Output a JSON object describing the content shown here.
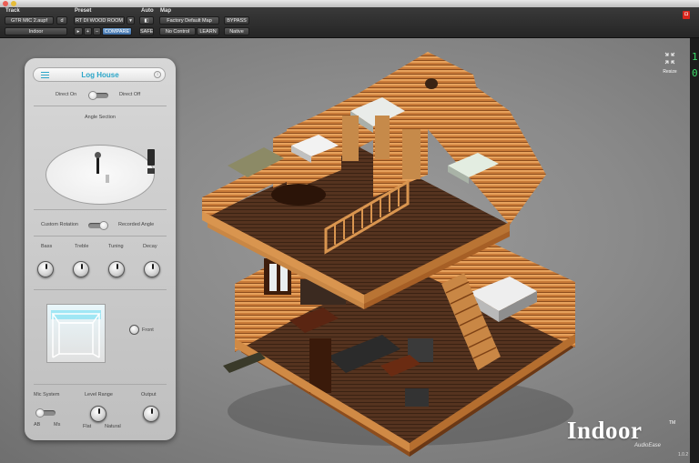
{
  "host": {
    "track_label": "Track",
    "track_name": "GTR MIC 2.aupf",
    "track_letter": "d",
    "track_insert": "Indoor",
    "preset_label": "Preset",
    "preset_name": "RT DI WOOD ROOM",
    "preset_plus": "+",
    "preset_minus": "−",
    "compare": "COMPARE",
    "auto_label": "Auto",
    "safe": "SAFE",
    "map_label": "Map",
    "map_name": "Factory Default Map",
    "no_control": "No Control",
    "learn": "LEARN",
    "bypass": "BYPASS",
    "native": "Native",
    "close_glyph": "✕",
    "record_glyph": "◘",
    "side_digits": [
      "1",
      "0"
    ]
  },
  "panel": {
    "title": "Log House",
    "direct_on": "Direct On",
    "direct_off": "Direct Off",
    "angle_section": "Angle Section",
    "custom_rotation": "Custom Rotation",
    "recorded_angle": "Recorded Angle",
    "knobs": [
      {
        "label": "Bass"
      },
      {
        "label": "Treble"
      },
      {
        "label": "Tuning"
      },
      {
        "label": "Decay"
      }
    ],
    "front_label": "Front",
    "mic_system_label": "Mic System",
    "mic_ab": "AB",
    "mic_ms": "Ms",
    "level_range_label": "Level Range",
    "level_flat": "Flat",
    "level_natural": "Natural",
    "output_label": "Output"
  },
  "stage": {
    "resize_label": "Resize",
    "logo": "Indoor",
    "logo_tm": "TM",
    "brand": "AudioEase",
    "version": "1.0.2"
  },
  "colors": {
    "accent": "#2aa5c8",
    "wood_light": "#d98f48",
    "wood_dark": "#8a4b1c",
    "floor": "#4a2d1c",
    "record": "#d9261c"
  }
}
